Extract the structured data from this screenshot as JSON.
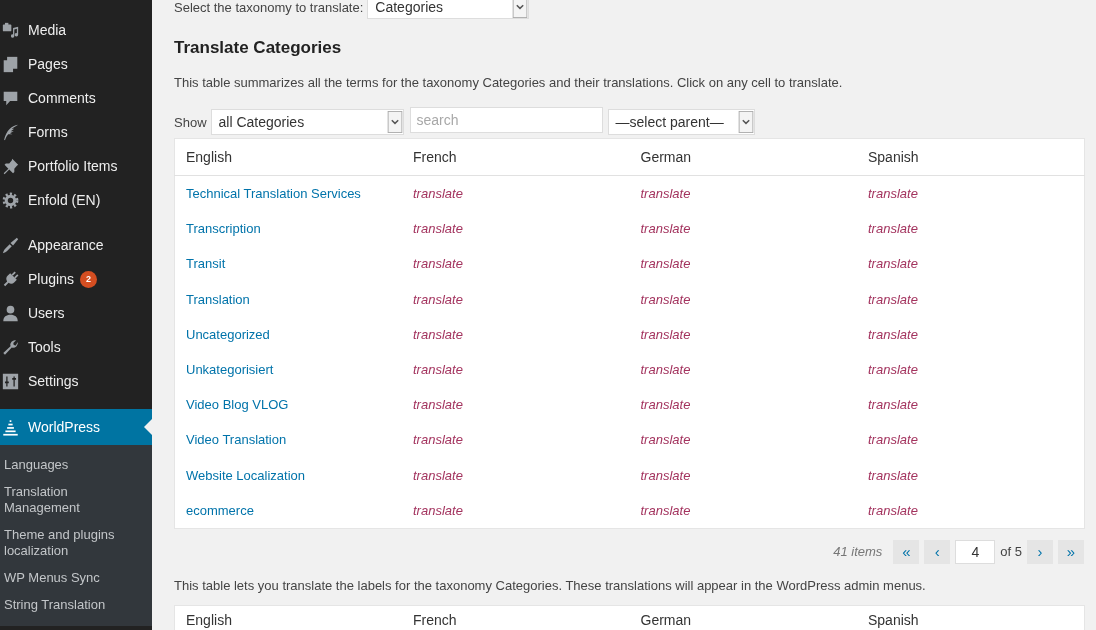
{
  "sidebar": {
    "menu_groups": [
      {
        "items": [
          {
            "label": "Media",
            "selected": false
          },
          {
            "label": "Pages",
            "selected": false
          },
          {
            "label": "Comments",
            "selected": false
          },
          {
            "label": "Forms",
            "selected": false
          },
          {
            "label": "Portfolio Items",
            "selected": false
          },
          {
            "label": "Enfold (EN)",
            "selected": false
          }
        ]
      },
      {
        "items": [
          {
            "label": "Appearance",
            "selected": false
          },
          {
            "label": "Plugins",
            "selected": false,
            "badge": "2"
          },
          {
            "label": "Users",
            "selected": false
          },
          {
            "label": "Tools",
            "selected": false
          },
          {
            "label": "Settings",
            "selected": false
          }
        ]
      },
      {
        "items": [
          {
            "label": "WorldPress",
            "selected": true,
            "submenu": [
              {
                "label": "Languages",
                "selected": false
              },
              {
                "label": "Translation Management",
                "selected": false
              },
              {
                "label": "Theme and plugins localization",
                "selected": false
              },
              {
                "label": "WP Menus Sync",
                "selected": false
              },
              {
                "label": "String Translation",
                "selected": false
              }
            ]
          }
        ]
      }
    ]
  },
  "taxonomy_picker": {
    "label": "Select the taxonomy to translate:",
    "value": "Categories"
  },
  "heading": "Translate Categories",
  "intro": "This table summarizes all the terms for the taxonomy Categories and their translations. Click on any cell to translate.",
  "filters": {
    "show_label": "Show",
    "term_select": "all Categories",
    "search": {
      "placeholder": "search"
    },
    "parent_select": "—select parent—"
  },
  "table": {
    "columns": [
      "English",
      "French",
      "German",
      "Spanish"
    ],
    "rows": [
      {
        "term": "Technical Translation Services",
        "translations": [
          "translate",
          "translate",
          "translate"
        ]
      },
      {
        "term": "Transcription",
        "translations": [
          "translate",
          "translate",
          "translate"
        ]
      },
      {
        "term": "Transit",
        "translations": [
          "translate",
          "translate",
          "translate"
        ]
      },
      {
        "term": "Translation",
        "translations": [
          "translate",
          "translate",
          "translate"
        ]
      },
      {
        "term": "Uncategorized",
        "translations": [
          "translate",
          "translate",
          "translate"
        ]
      },
      {
        "term": "Unkategorisiert",
        "translations": [
          "translate",
          "translate",
          "translate"
        ]
      },
      {
        "term": "Video Blog VLOG",
        "translations": [
          "translate",
          "translate",
          "translate"
        ]
      },
      {
        "term": "Video Translation",
        "translations": [
          "translate",
          "translate",
          "translate"
        ]
      },
      {
        "term": "Website Localization",
        "translations": [
          "translate",
          "translate",
          "translate"
        ]
      },
      {
        "term": "ecommerce",
        "translations": [
          "translate",
          "translate",
          "translate"
        ]
      }
    ]
  },
  "pagination": {
    "count": "41 items",
    "first": "«",
    "prev": "‹",
    "page": "4",
    "of": "of 5",
    "next": "›",
    "last": "»"
  },
  "labels_intro": "This table lets you translate the labels for the taxonomy Categories. These translations will appear in the WordPress admin menus.",
  "labels_table": {
    "columns": [
      "English",
      "French",
      "German",
      "Spanish"
    ]
  }
}
